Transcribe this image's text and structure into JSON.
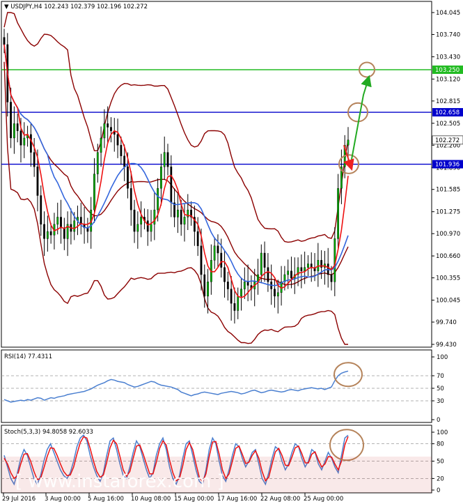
{
  "chart_data": {
    "type": "candlestick",
    "header": {
      "symbol": "USDJPY,H4",
      "open": "102.243",
      "high": "102.379",
      "low": "102.196",
      "close": "102.272"
    },
    "price_axis": {
      "ylim": [
        99.43,
        104.045
      ],
      "ticks": [
        "104.045",
        "103.740",
        "103.430",
        "103.120",
        "102.815",
        "102.505",
        "102.200",
        "101.890",
        "101.585",
        "101.275",
        "100.970",
        "100.660",
        "100.355",
        "100.045",
        "99.740",
        "99.430"
      ]
    },
    "levels": [
      {
        "value": 103.25,
        "label": "103.250",
        "color": "#22bb22"
      },
      {
        "value": 102.658,
        "label": "102.658",
        "color": "#0000cc"
      },
      {
        "value": 101.936,
        "label": "101.936",
        "color": "#0000cc"
      }
    ],
    "current_price": {
      "value": 102.272,
      "label": "102.272"
    },
    "close_series": [
      103.6,
      102.8,
      102.3,
      102.5,
      102.4,
      102.2,
      102.3,
      102.35,
      102.1,
      101.9,
      101.5,
      101.1,
      100.9,
      101.0,
      100.95,
      101.1,
      101.2,
      101.05,
      100.9,
      101.1,
      101.0,
      101.15,
      101.2,
      101.1,
      101.05,
      101.0,
      101.3,
      101.8,
      102.1,
      102.3,
      102.5,
      102.45,
      102.4,
      102.35,
      102.2,
      102.05,
      101.9,
      101.6,
      101.3,
      101.0,
      101.1,
      101.2,
      101.15,
      101.0,
      101.1,
      101.3,
      101.6,
      101.9,
      102.1,
      101.9,
      101.4,
      101.2,
      101.3,
      101.1,
      101.2,
      101.3,
      101.2,
      101.0,
      100.8,
      100.4,
      100.1,
      100.3,
      100.6,
      100.8,
      100.7,
      100.5,
      100.3,
      100.2,
      100.0,
      99.9,
      100.1,
      100.2,
      100.3,
      100.25,
      100.2,
      100.3,
      100.4,
      100.7,
      100.5,
      100.3,
      100.2,
      100.1,
      100.15,
      100.3,
      100.4,
      100.45,
      100.35,
      100.4,
      100.5,
      100.45,
      100.5,
      100.55,
      100.5,
      100.45,
      100.6,
      100.5,
      100.55,
      100.4,
      100.3,
      100.9,
      101.6,
      101.9,
      102.2,
      102.272
    ],
    "moving_averages": [
      {
        "color": "#ee1111",
        "period": 5
      },
      {
        "color": "#3366dd",
        "period": 14
      }
    ],
    "bands_color": "#8b0000",
    "x_ticks": [
      "29 Jul 2016",
      "3 Aug 00:00",
      "5 Aug 16:00",
      "10 Aug 08:00",
      "15 Aug 00:00",
      "17 Aug 16:00",
      "22 Aug 08:00",
      "25 Aug 00:00"
    ],
    "rsi": {
      "label": "RSI(14) 77.4311",
      "ylim": [
        0,
        100
      ],
      "ticks": [
        "100",
        "70",
        "50",
        "30",
        "0"
      ],
      "levels": [
        70,
        50,
        30
      ],
      "color": "#4a7fd0",
      "values": [
        32,
        30,
        28,
        29,
        30,
        31,
        30,
        32,
        31,
        33,
        35,
        34,
        31,
        33,
        35,
        34,
        36,
        37,
        38,
        40,
        41,
        42,
        43,
        44,
        45,
        47,
        49,
        52,
        55,
        57,
        59,
        62,
        64,
        63,
        61,
        60,
        59,
        56,
        54,
        52,
        53,
        55,
        57,
        59,
        61,
        60,
        57,
        55,
        54,
        53,
        52,
        50,
        48,
        44,
        42,
        40,
        38,
        40,
        41,
        43,
        44,
        43,
        42,
        41,
        40,
        42,
        43,
        44,
        45,
        44,
        43,
        41,
        42,
        44,
        46,
        47,
        45,
        43,
        44,
        46,
        47,
        46,
        45,
        44,
        45,
        47,
        48,
        47,
        46,
        48,
        49,
        50,
        51,
        50,
        49,
        50,
        48,
        50,
        52,
        62,
        70,
        74,
        76,
        77.43
      ]
    },
    "stoch": {
      "label": "Stoch(5,3,3) 94.8058 92.6033",
      "ylim": [
        0,
        100
      ],
      "ticks": [
        "100",
        "80",
        "50",
        "20",
        "0"
      ],
      "levels": [
        80,
        50,
        20
      ],
      "main_color": "#4a7fd0",
      "signal_color": "#ee1111",
      "main": [
        60,
        40,
        20,
        10,
        30,
        55,
        70,
        60,
        40,
        20,
        10,
        25,
        50,
        70,
        80,
        65,
        50,
        35,
        25,
        20,
        30,
        50,
        75,
        90,
        95,
        85,
        60,
        40,
        25,
        15,
        30,
        60,
        85,
        90,
        70,
        45,
        25,
        20,
        40,
        65,
        85,
        75,
        55,
        35,
        20,
        30,
        60,
        80,
        90,
        70,
        40,
        20,
        10,
        25,
        55,
        80,
        85,
        60,
        35,
        15,
        10,
        35,
        70,
        90,
        80,
        50,
        25,
        15,
        35,
        60,
        80,
        75,
        55,
        40,
        50,
        65,
        70,
        45,
        20,
        10,
        30,
        55,
        75,
        70,
        50,
        35,
        45,
        65,
        80,
        75,
        55,
        40,
        50,
        70,
        65,
        45,
        35,
        50,
        65,
        55,
        40,
        30,
        60,
        90,
        94.8
      ],
      "signal": [
        55,
        45,
        30,
        20,
        25,
        45,
        62,
        63,
        50,
        32,
        18,
        20,
        38,
        58,
        73,
        72,
        60,
        45,
        32,
        25,
        26,
        40,
        62,
        82,
        92,
        90,
        72,
        50,
        32,
        22,
        26,
        48,
        73,
        86,
        80,
        58,
        35,
        24,
        32,
        55,
        76,
        78,
        63,
        45,
        28,
        28,
        48,
        72,
        85,
        78,
        52,
        30,
        16,
        20,
        42,
        70,
        82,
        70,
        45,
        22,
        14,
        28,
        58,
        83,
        84,
        62,
        35,
        20,
        28,
        50,
        72,
        76,
        62,
        46,
        48,
        60,
        68,
        55,
        32,
        16,
        22,
        45,
        66,
        72,
        60,
        43,
        42,
        57,
        73,
        76,
        63,
        47,
        47,
        62,
        66,
        52,
        40,
        45,
        58,
        57,
        45,
        35,
        50,
        78,
        92.6
      ]
    },
    "watermark": "[ www.instaforex.com ]"
  }
}
